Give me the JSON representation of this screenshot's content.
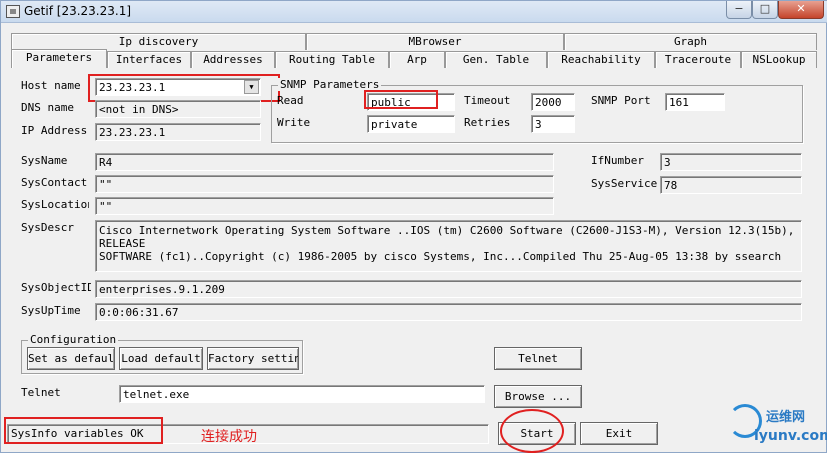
{
  "window": {
    "title": "Getif [23.23.23.1]",
    "controls": {
      "minimize": "−",
      "maximize": "□",
      "close": "✕"
    }
  },
  "tabs": {
    "row1": [
      "Ip discovery",
      "MBrowser",
      "Graph"
    ],
    "row2": [
      "Parameters",
      "Interfaces",
      "Addresses",
      "Routing Table",
      "Arp",
      "Gen. Table",
      "Reachability",
      "Traceroute",
      "NSLookup"
    ],
    "active": "Parameters"
  },
  "host": {
    "host_name_label": "Host name",
    "host_name_value": "23.23.23.1",
    "dns_label": "DNS name",
    "dns_value": "<not in DNS>",
    "ip_label": "IP Address",
    "ip_value": "23.23.23.1"
  },
  "snmp": {
    "group_title": "SNMP Parameters",
    "read_label": "Read",
    "read_value": "public",
    "write_label": "Write",
    "write_value": "private",
    "timeout_label": "Timeout",
    "timeout_value": "2000",
    "retries_label": "Retries",
    "retries_value": "3",
    "port_label": "SNMP Port",
    "port_value": "161"
  },
  "sys": {
    "name_label": "SysName",
    "name_value": "R4",
    "contact_label": "SysContact",
    "contact_value": "\"\"",
    "location_label": "SysLocation",
    "location_value": "\"\"",
    "descr_label": "SysDescr",
    "descr_value": "Cisco Internetwork Operating System Software ..IOS (tm) C2600 Software (C2600-J1S3-M), Version 12.3(15b), RELEASE\nSOFTWARE (fc1)..Copyright (c) 1986-2005 by cisco Systems, Inc...Compiled Thu 25-Aug-05 13:38 by ssearch",
    "objectid_label": "SysObjectID",
    "objectid_value": "enterprises.9.1.209",
    "uptime_label": "SysUpTime",
    "uptime_value": "0:0:06:31.67",
    "ifnumber_label": "IfNumber",
    "ifnumber_value": "3",
    "services_label": "SysServices",
    "services_value": "78"
  },
  "config": {
    "group_title": "Configuration",
    "set_default": "Set as default",
    "load_default": "Load default",
    "factory_setting": "Factory setting"
  },
  "telnet": {
    "button": "Telnet",
    "label": "Telnet",
    "value": "telnet.exe",
    "browse": "Browse ..."
  },
  "status": {
    "text": "SysInfo variables OK",
    "start": "Start",
    "exit": "Exit"
  },
  "annotation": {
    "text": "连接成功",
    "color": "#e02020"
  },
  "watermark": {
    "top": "运维网",
    "bottom": "iyunv.com"
  }
}
